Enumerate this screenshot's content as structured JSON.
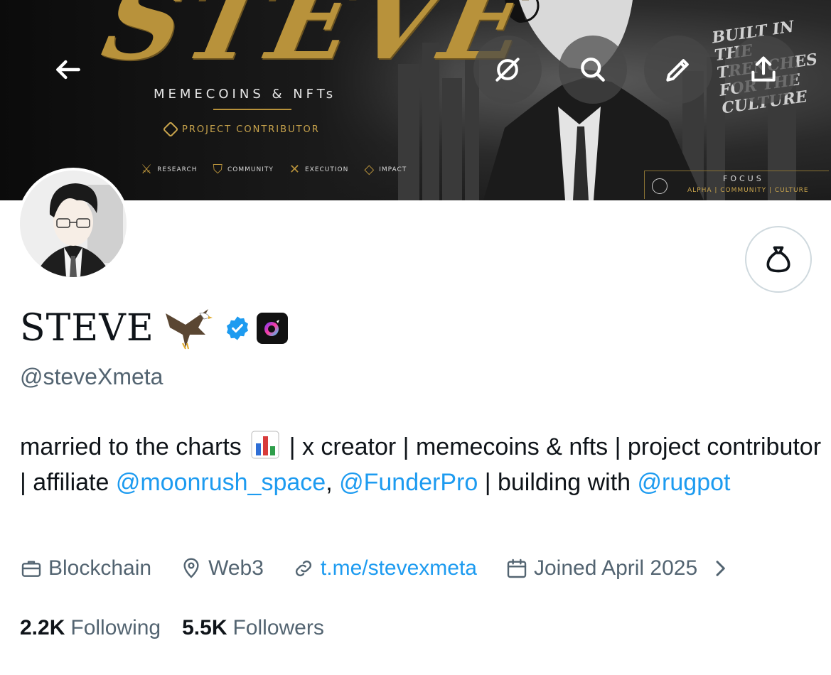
{
  "banner": {
    "headline": "STEVE",
    "subtitle": "MEMECOINS & NFTs",
    "role": "PROJECT CONTRIBUTOR",
    "pillars": [
      "RESEARCH",
      "COMMUNITY",
      "EXECUTION",
      "IMPACT"
    ],
    "slogan": "BUILT IN THE TRENCHES FOR THE CULTURE",
    "focus_title": "FOCUS",
    "focus_tags": "ALPHA | COMMUNITY | CULTURE"
  },
  "nav": {
    "back_icon": "arrow-left-icon",
    "grok_icon": "grok-icon",
    "search_icon": "search-icon",
    "edit_icon": "pencil-icon",
    "share_icon": "share-icon"
  },
  "profile": {
    "display_name": "STEVE",
    "handle": "@steveXmeta",
    "bio": {
      "part1": "married to the charts",
      "part2": " | x creator | memecoins & nfts | project contributor | affiliate ",
      "mention1": "@moonrush_space",
      "sep": ", ",
      "mention2": "@FunderPro",
      "part3": " | building with ",
      "mention3": "@rugpot"
    },
    "meta": {
      "category": "Blockchain",
      "location": "Web3",
      "link": "t.me/stevexmeta",
      "joined": "Joined April 2025"
    },
    "stats": {
      "following_count": "2.2K",
      "following_label": "Following",
      "followers_count": "5.5K",
      "followers_label": "Followers"
    }
  },
  "colors": {
    "accent": "#1d9bf0",
    "secondary_text": "#536471",
    "primary_text": "#0f1419",
    "banner_gold": "#b8923b"
  }
}
